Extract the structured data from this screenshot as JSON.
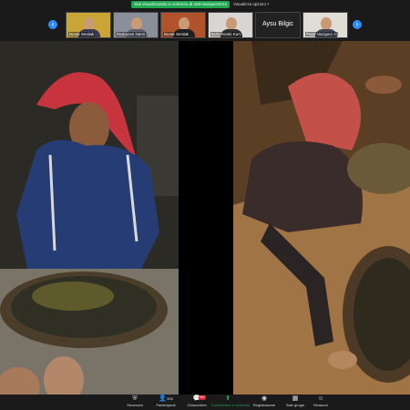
{
  "meeting": {
    "share_banner": "Stai visualizzando lo schermo di ratti-marquez2014",
    "view_options": "Visualizza opzioni ˅"
  },
  "gallery": {
    "tiles": [
      {
        "name": "Burak Serdak"
      },
      {
        "name": "Ramazan Nemi"
      },
      {
        "name": "Burak Serdak"
      },
      {
        "name": "Bolschinski Kurt"
      },
      {
        "name": "Aysu Bilgic"
      },
      {
        "name": "Pepe Vazquez A."
      }
    ],
    "prev_icon": "chevron-left-icon",
    "next_icon": "chevron-right-icon"
  },
  "toolbar": {
    "items": [
      {
        "label": "Sicurezza",
        "icon": "shield-icon"
      },
      {
        "label": "Partecipanti",
        "icon": "participants-icon",
        "count": "308"
      },
      {
        "label": "Chiacchiera",
        "icon": "chat-icon",
        "badge": "99+"
      },
      {
        "label": "Condividere lo schermo",
        "icon": "share-screen-icon"
      },
      {
        "label": "Registrazione",
        "icon": "record-icon"
      },
      {
        "label": "Sale gruppi",
        "icon": "breakout-rooms-icon"
      },
      {
        "label": "Reazioni",
        "icon": "reactions-icon"
      }
    ]
  },
  "colors": {
    "share_green": "#1fa84f",
    "arrow_blue": "#2d8cff",
    "bar_bg": "#1a1a1a"
  }
}
